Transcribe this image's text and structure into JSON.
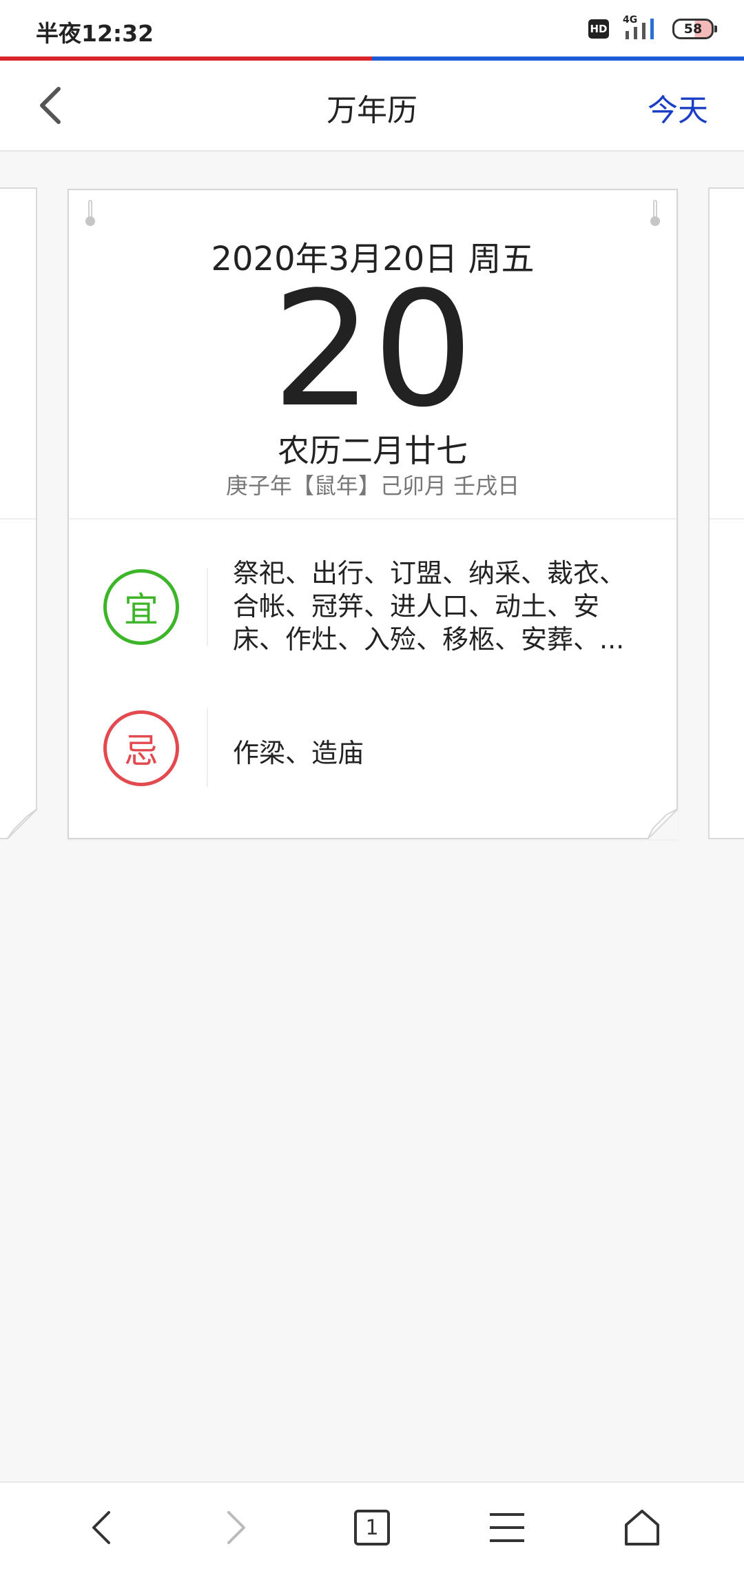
{
  "status_bar": {
    "time": "半夜12:32",
    "hd_label": "HD",
    "network": "4G",
    "battery": "58"
  },
  "progress": {
    "fraction": 0.5,
    "left_color": "#d8262a",
    "right_color": "#1e5bd6"
  },
  "header": {
    "title": "万年历",
    "today_label": "今天",
    "back_icon": "chevron-left-icon"
  },
  "card": {
    "date_line": "2020年3月20日 周五",
    "day": "20",
    "lunar_date": "农历二月廿七",
    "ganzhi": "庚子年【鼠年】己卯月 壬戌日",
    "yi": {
      "label": "宜",
      "color": "#3cb528",
      "text": "祭祀、出行、订盟、纳采、裁衣、合帐、冠笄、进人口、动土、安床、作灶、入殓、移柩、安葬、..."
    },
    "ji": {
      "label": "忌",
      "color": "#e24a4f",
      "text": "作梁、造庙"
    }
  },
  "bottom_bar": {
    "tab_count": "1",
    "icons": [
      "back-icon",
      "forward-icon",
      "tabs-icon",
      "menu-icon",
      "home-icon"
    ]
  }
}
